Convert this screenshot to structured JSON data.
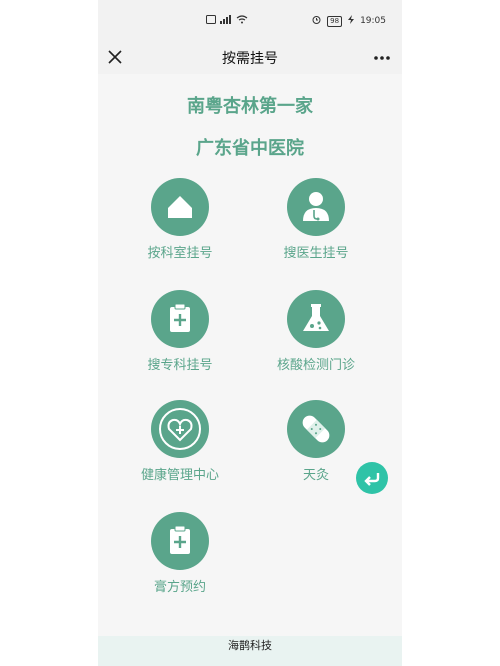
{
  "status_bar": {
    "left_icons": [
      "sim-icon",
      "signal-icon",
      "wifi-icon"
    ],
    "right": {
      "alarm": "alarm-icon",
      "battery": "98",
      "charging_icon": "bolt-icon",
      "time": "19:05"
    }
  },
  "navbar": {
    "title": "按需挂号"
  },
  "header": {
    "line1": "南粤杏林第一家",
    "line2": "广东省中医院"
  },
  "menu": {
    "items": [
      {
        "label": "按科室挂号",
        "icon": "house-icon"
      },
      {
        "label": "搜医生挂号",
        "icon": "doctor-icon"
      },
      {
        "label": "搜专科挂号",
        "icon": "clipboard-plus-icon"
      },
      {
        "label": "核酸检测门诊",
        "icon": "flask-icon"
      },
      {
        "label": "健康管理中心",
        "icon": "heart-shield-icon"
      },
      {
        "label": "天灸",
        "icon": "bandage-icon"
      },
      {
        "label": "膏方预约",
        "icon": "clipboard-plus-icon"
      }
    ]
  },
  "footer": {
    "text": "海鹊科技"
  },
  "colors": {
    "accent": "#5aa58b",
    "float": "#2fc3a7"
  }
}
